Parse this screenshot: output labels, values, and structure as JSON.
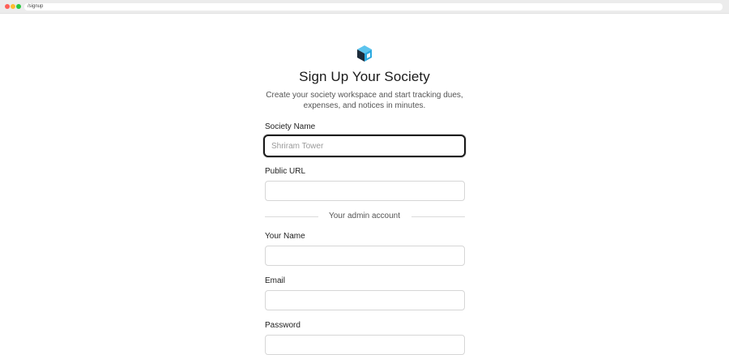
{
  "browser": {
    "url": "/signup"
  },
  "header": {
    "title": "Sign Up Your Society",
    "subtitle": "Create your society workspace and start tracking dues, expenses, and notices in minutes.",
    "logo_icon": "cube-icon"
  },
  "form": {
    "society_name": {
      "label": "Society Name",
      "placeholder": "Shriram Tower",
      "value": ""
    },
    "public_url": {
      "label": "Public URL",
      "placeholder": "",
      "value": ""
    },
    "divider_text": "Your admin account",
    "your_name": {
      "label": "Your Name",
      "placeholder": "",
      "value": ""
    },
    "email": {
      "label": "Email",
      "placeholder": "",
      "value": ""
    },
    "password": {
      "label": "Password",
      "placeholder": "",
      "value": ""
    }
  },
  "colors": {
    "focus_border": "#1a1a1a",
    "input_border": "#d6d6d6",
    "logo_primary": "#2aa9e0",
    "logo_dark": "#1c2b3a"
  }
}
